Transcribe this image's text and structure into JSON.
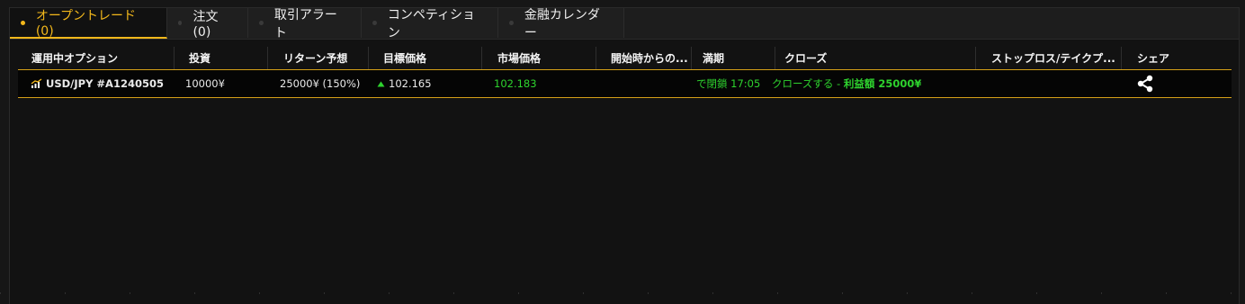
{
  "tabs": [
    {
      "label": "オープントレード (0)",
      "active": true
    },
    {
      "label": "注文 (0)",
      "active": false
    },
    {
      "label": "取引アラート",
      "active": false
    },
    {
      "label": "コンペティション",
      "active": false
    },
    {
      "label": "金融カレンダー",
      "active": false
    }
  ],
  "columns": {
    "option": "運用中オプション",
    "investment": "投資",
    "return": "リターン予想",
    "target": "目標価格",
    "market": "市場価格",
    "since_start": "開始時からの...",
    "expiry": "満期",
    "close": "クローズ",
    "stoploss": "ストップロス/テイクプ...",
    "share": "シェア"
  },
  "row": {
    "option": "USD/JPY #A1240505",
    "investment": "10000¥",
    "return": "25000¥ (150%)",
    "target": "102.165",
    "market": "102.183",
    "expiry": "で閉鎖 17:05",
    "close_action": "クローズする -",
    "close_profit": "利益額 25000¥"
  },
  "colors": {
    "accent": "#f3b81b",
    "profit": "#2ed22e",
    "background": "#121212"
  },
  "icons": {
    "tab_dot": "dot-icon",
    "option": "chart-icon",
    "target": "arrow-up-icon",
    "share": "share-icon"
  }
}
